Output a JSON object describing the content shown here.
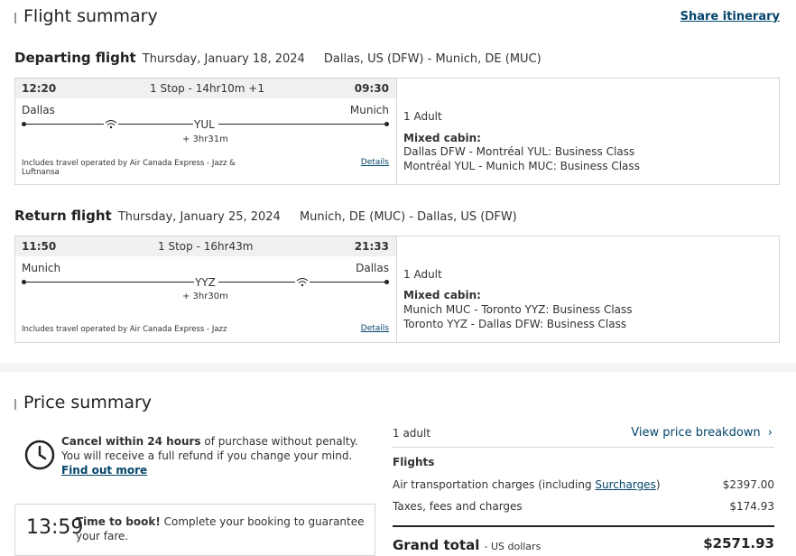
{
  "flight_summary": {
    "title": "Flight summary",
    "share_label": "Share itinerary",
    "departing": {
      "heading": "Departing flight",
      "date": "Thursday, January 18, 2024",
      "route": "Dallas, US (DFW) - Munich, DE (MUC)",
      "depart_time": "12:20",
      "stops": "1 Stop - 14hr10m +1",
      "arrive_time": "09:30",
      "origin": "Dallas",
      "destination": "Munich",
      "connection": "YUL",
      "layover": "+ 3hr31m",
      "operated_by": "Includes travel operated by Air Canada Express - Jazz & Luftnansa",
      "details_label": "Details",
      "passengers": "1 Adult",
      "cabin_heading": "Mixed cabin:",
      "cabin_line1": "Dallas DFW - Montréal YUL: Business Class",
      "cabin_line2": "Montréal YUL - Munich MUC: Business Class"
    },
    "return": {
      "heading": "Return flight",
      "date": "Thursday, January 25, 2024",
      "route": "Munich, DE (MUC) - Dallas, US (DFW)",
      "depart_time": "11:50",
      "stops": "1 Stop - 16hr43m",
      "arrive_time": "21:33",
      "origin": "Munich",
      "destination": "Dallas",
      "connection": "YYZ",
      "layover": "+ 3hr30m",
      "operated_by": "Includes travel operated by Air Canada Express - Jazz",
      "details_label": "Details",
      "passengers": "1 Adult",
      "cabin_heading": "Mixed cabin:",
      "cabin_line1": "Munich MUC - Toronto YYZ: Business Class",
      "cabin_line2": "Toronto YYZ - Dallas DFW: Business Class"
    }
  },
  "price_summary": {
    "title": "Price summary",
    "cancel_bold": "Cancel within 24 hours",
    "cancel_text": " of purchase without penalty. You will receive a full refund if you change your mind.",
    "find_out_more": "Find out more",
    "timer": "13:59",
    "time_bold": "Time to book!",
    "time_text": " Complete your booking to guarantee your fare.",
    "adults": "1 adult",
    "view_breakdown": "View price breakdown",
    "flights_heading": "Flights",
    "air_label_prefix": "Air transportation charges (including ",
    "air_label_link": "Surcharges",
    "air_label_suffix": ")",
    "air_value": "$2397.00",
    "taxes_label": "Taxes, fees and charges",
    "taxes_value": "$174.93",
    "grand_label": "Grand total",
    "grand_currency": "- US dollars",
    "grand_value": "$2571.93"
  }
}
